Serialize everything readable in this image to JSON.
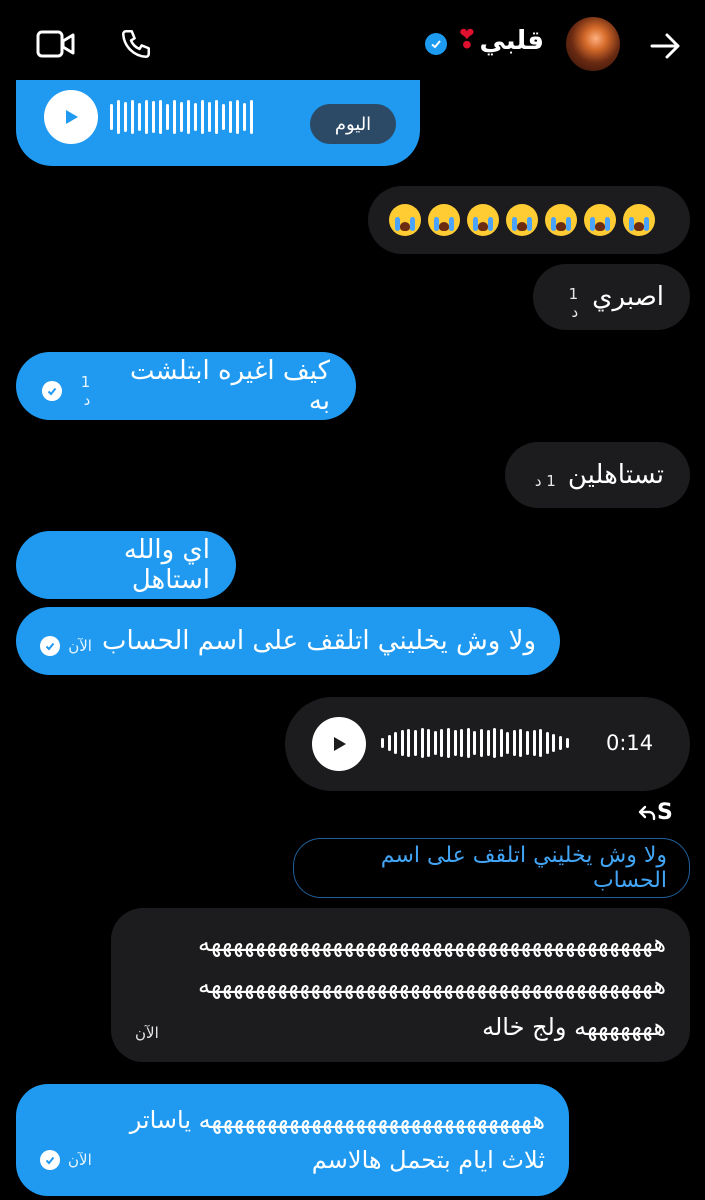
{
  "header": {
    "contact_name": "قلبي",
    "heart_emoji": "❣",
    "icons": [
      "video-call-icon",
      "phone-icon",
      "verified-icon",
      "back-arrow-icon"
    ]
  },
  "messages": [
    {
      "type": "voice",
      "side": "left",
      "color": "blue",
      "date_pill": "اليوم"
    },
    {
      "type": "emoji",
      "side": "right",
      "text": "😭😭😭😭😭😭😭"
    },
    {
      "type": "text",
      "side": "right",
      "text": "اصبري",
      "time": "1 د"
    },
    {
      "type": "text",
      "side": "left",
      "text": "كيف اغيره ابتلشت به",
      "time": "1 د"
    },
    {
      "type": "text",
      "side": "right",
      "text": "تستاهلين",
      "time": "1 د"
    },
    {
      "type": "text",
      "side": "left",
      "text": "اي والله استاهل"
    },
    {
      "type": "text",
      "side": "left",
      "text": "ولا وش يخليني اتلقف على اسم الحساب",
      "time": "الآن"
    },
    {
      "type": "voice",
      "side": "right",
      "duration": "0:14"
    },
    {
      "type": "reply",
      "side": "right",
      "reply_label": "S",
      "quoted": "ولا وش يخليني اتلقف على اسم الحساب",
      "line1": "هههههههههههههههههههههههههههههههههههههههههه",
      "line2": "هههههههههههههههههههههههههههههههههههههههههه",
      "line3": "هههههههه ولج خاله",
      "time": "الآن"
    },
    {
      "type": "text",
      "side": "left",
      "line1": "ههههههههههههههههههههههههههههههه ياساتر",
      "line2": "ثلاث ايام بتحمل هالاسم",
      "time": "الآن"
    }
  ],
  "colors": {
    "blue": "#1f9af0",
    "dark": "#1c1c1e",
    "background": "#000000"
  }
}
